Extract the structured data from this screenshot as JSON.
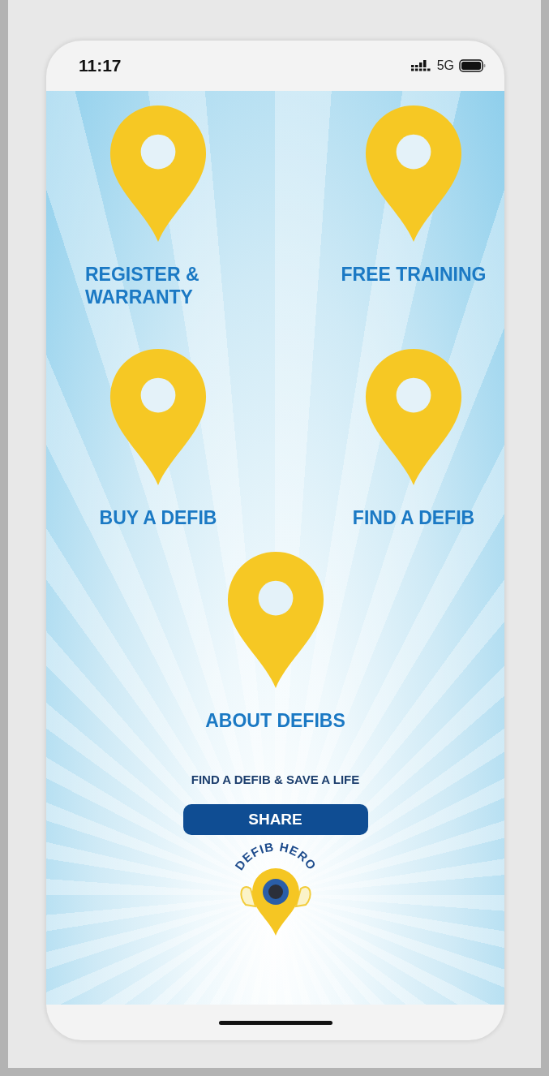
{
  "status_bar": {
    "time": "11:17",
    "network": "5G"
  },
  "tiles": [
    {
      "label": "REGISTER & WARRANTY"
    },
    {
      "label": "FREE TRAINING"
    },
    {
      "label": "BUY A DEFIB"
    },
    {
      "label": "FIND A DEFIB"
    },
    {
      "label": "ABOUT DEFIBS"
    }
  ],
  "tagline": "FIND A DEFIB & SAVE A LIFE",
  "share_button": "SHARE",
  "logo": {
    "text": "DEFIB HERO"
  }
}
